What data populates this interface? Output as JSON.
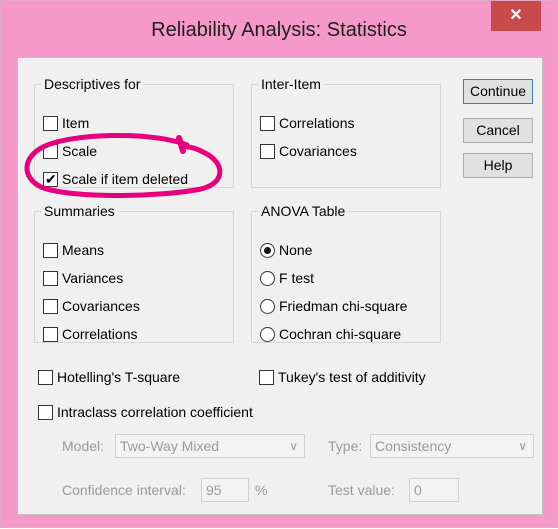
{
  "window": {
    "title": "Reliability Analysis: Statistics",
    "close_glyph": "✕"
  },
  "descriptives": {
    "legend": "Descriptives for",
    "items": [
      {
        "label": "Item",
        "checked": false
      },
      {
        "label": "Scale",
        "checked": false
      },
      {
        "label": "Scale if item deleted",
        "checked": true
      }
    ]
  },
  "inter_item": {
    "legend": "Inter-Item",
    "items": [
      {
        "label": "Correlations",
        "checked": false
      },
      {
        "label": "Covariances",
        "checked": false
      }
    ]
  },
  "summaries": {
    "legend": "Summaries",
    "items": [
      {
        "label": "Means",
        "checked": false
      },
      {
        "label": "Variances",
        "checked": false
      },
      {
        "label": "Covariances",
        "checked": false
      },
      {
        "label": "Correlations",
        "checked": false
      }
    ]
  },
  "anova": {
    "legend": "ANOVA Table",
    "options": [
      "None",
      "F test",
      "Friedman chi-square",
      "Cochran chi-square"
    ],
    "selected": "None"
  },
  "buttons": {
    "continue": "Continue",
    "cancel": "Cancel",
    "help": "Help"
  },
  "hotelling": {
    "label": "Hotelling's T-square",
    "checked": false
  },
  "tukey": {
    "label": "Tukey's test of additivity",
    "checked": false
  },
  "icc": {
    "label": "Intraclass correlation coefficient",
    "checked": false,
    "model_label": "Model:",
    "model_value": "Two-Way Mixed",
    "type_label": "Type:",
    "type_value": "Consistency",
    "ci_label": "Confidence interval:",
    "ci_value": "95",
    "ci_unit": "%",
    "test_value_label": "Test value:",
    "test_value": "0"
  },
  "annotation": {
    "color": "#e6007e"
  }
}
